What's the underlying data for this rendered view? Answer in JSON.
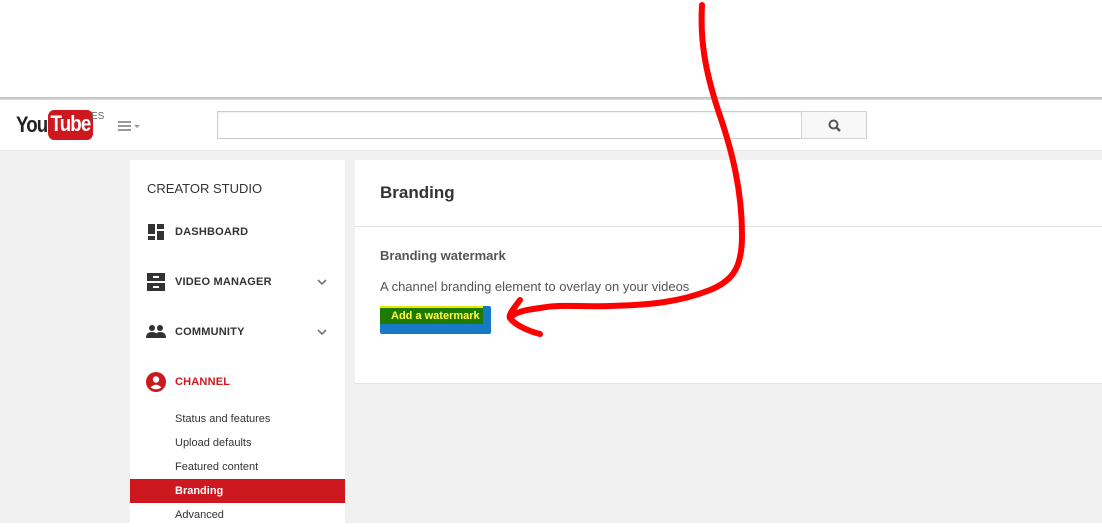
{
  "header": {
    "logo_you": "You",
    "logo_tube": "Tube",
    "region": "ES",
    "search_value": "",
    "search_placeholder": ""
  },
  "sidebar": {
    "title": "CREATOR STUDIO",
    "items": [
      {
        "label": "DASHBOARD",
        "icon": "dashboard-icon",
        "expandable": false
      },
      {
        "label": "VIDEO MANAGER",
        "icon": "video-manager-icon",
        "expandable": true
      },
      {
        "label": "COMMUNITY",
        "icon": "community-icon",
        "expandable": true
      },
      {
        "label": "CHANNEL",
        "icon": "channel-icon",
        "expandable": false,
        "active": true
      }
    ],
    "subitems": [
      {
        "label": "Status and features"
      },
      {
        "label": "Upload defaults"
      },
      {
        "label": "Featured content"
      },
      {
        "label": "Branding",
        "active": true
      },
      {
        "label": "Advanced"
      }
    ]
  },
  "content": {
    "title": "Branding",
    "section_title": "Branding watermark",
    "section_desc": "A channel branding element to overlay on your videos",
    "button_label": "Add a watermark"
  },
  "colors": {
    "brand_red": "#cc181e",
    "button_blue": "#167ac6",
    "annotation_red": "#ff0000"
  }
}
